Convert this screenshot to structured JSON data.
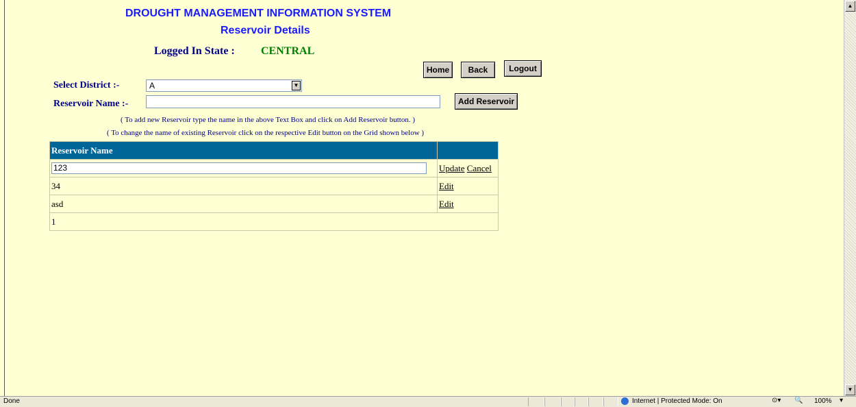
{
  "header": {
    "system_title": "DROUGHT MANAGEMENT INFORMATION SYSTEM",
    "page_title": "Reservoir Details",
    "logged_in_label": "Logged In State :",
    "logged_in_state": "CENTRAL"
  },
  "nav": {
    "home": "Home",
    "back": "Back",
    "logout": "Logout"
  },
  "form": {
    "district_label": "Select District :-",
    "district_value": "A",
    "reservoir_label": "Reservoir Name :-",
    "reservoir_value": "",
    "add_button": "Add Reservoir",
    "note1": "( To add new Reservoir type the name in the above Text Box and click on Add Reservoir button. )",
    "note2": "( To change the name of existing Reservoir click on the respective Edit button on the Grid shown below )"
  },
  "grid": {
    "header": "Reservoir Name",
    "editing_row": {
      "value": "123",
      "update": "Update",
      "cancel": "Cancel"
    },
    "rows": [
      {
        "name": "34",
        "action": "Edit"
      },
      {
        "name": "asd",
        "action": "Edit"
      }
    ],
    "pager": "1"
  },
  "status": {
    "text": "Done",
    "zone": "Internet | Protected Mode: On",
    "zoom": "100%"
  },
  "colors": {
    "background": "#ffffd4",
    "title_blue": "#1a1aff",
    "state_green": "#008000",
    "grid_header": "#006699"
  }
}
